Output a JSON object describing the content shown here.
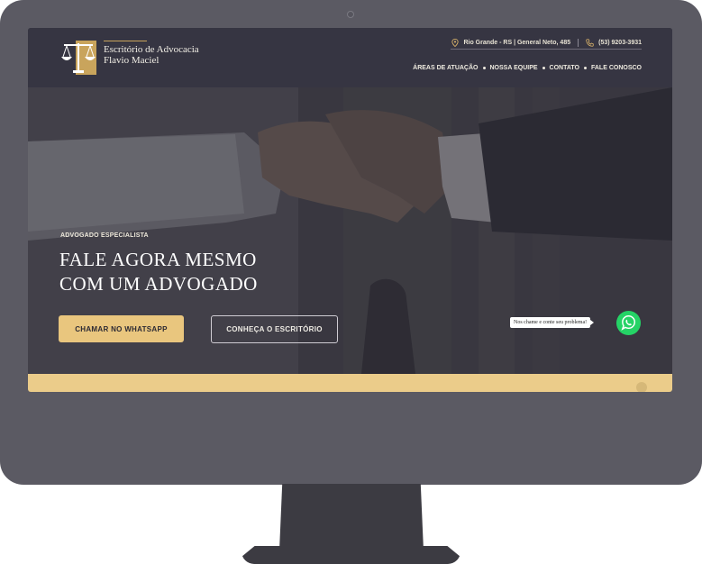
{
  "header": {
    "logo_line1": "Escritório de Advocacia",
    "logo_line2": "Flavio Maciel",
    "address": "Rio Grande - RS | General Neto, 485",
    "phone": "(53) 9203-3931",
    "nav": [
      {
        "label": "ÁREAS DE ATUAÇÃO"
      },
      {
        "label": "NOSSA EQUIPE"
      },
      {
        "label": "CONTATO"
      },
      {
        "label": "FALE CONOSCO"
      }
    ]
  },
  "hero": {
    "eyebrow": "ADVOGADO ESPECIALISTA",
    "headline_line1": "FALE AGORA MESMO",
    "headline_line2": "COM UM ADVOGADO",
    "cta_primary": "CHAMAR NO WHATSAPP",
    "cta_secondary": "CONHEÇA O ESCRITÓRIO"
  },
  "whatsapp": {
    "bubble_text": "Nos chame e conte seu problema!"
  },
  "colors": {
    "accent_gold": "#e9c67e",
    "header_bg": "#363542",
    "whatsapp_green": "#25d366"
  },
  "icons": [
    "scales-logo-icon",
    "map-pin-icon",
    "phone-icon",
    "whatsapp-icon",
    "monitor-camera-icon"
  ]
}
